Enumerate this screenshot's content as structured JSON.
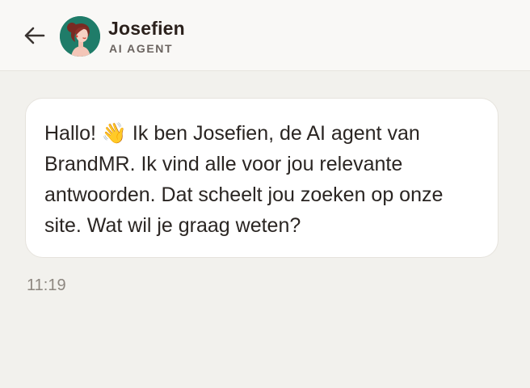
{
  "header": {
    "back_icon": "arrow-left-icon",
    "agent_name": "Josefien",
    "agent_role": "AI AGENT",
    "avatar_bg": "#1f7c69"
  },
  "messages": [
    {
      "text": "Hallo! 👋 Ik ben Josefien, de AI agent van BrandMR. Ik vind alle voor jou relevante antwoorden. Dat scheelt jou zoeken op onze site. Wat wil je graag weten?",
      "time": "11:19"
    }
  ]
}
